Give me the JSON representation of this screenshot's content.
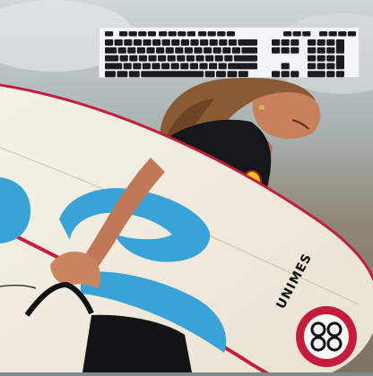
{
  "photo": {
    "scene": "surfer-carrying-board",
    "colors": {
      "water_top": "#cfd6d8",
      "water_mid": "#9aa6a5",
      "sand": "#8c7d6c",
      "board": "#f3eee2",
      "board_rail": "#c41d3c",
      "board_swirl": "#3aa3d6",
      "wetsuit": "#141618",
      "skin": "#c07857",
      "hair": "#8a5a34"
    },
    "board_text": "UNIMES"
  },
  "keyboard": {
    "icon": "keyboard-icon",
    "key_color": "#1b1c1f",
    "base_color": "#f4f5f6"
  }
}
